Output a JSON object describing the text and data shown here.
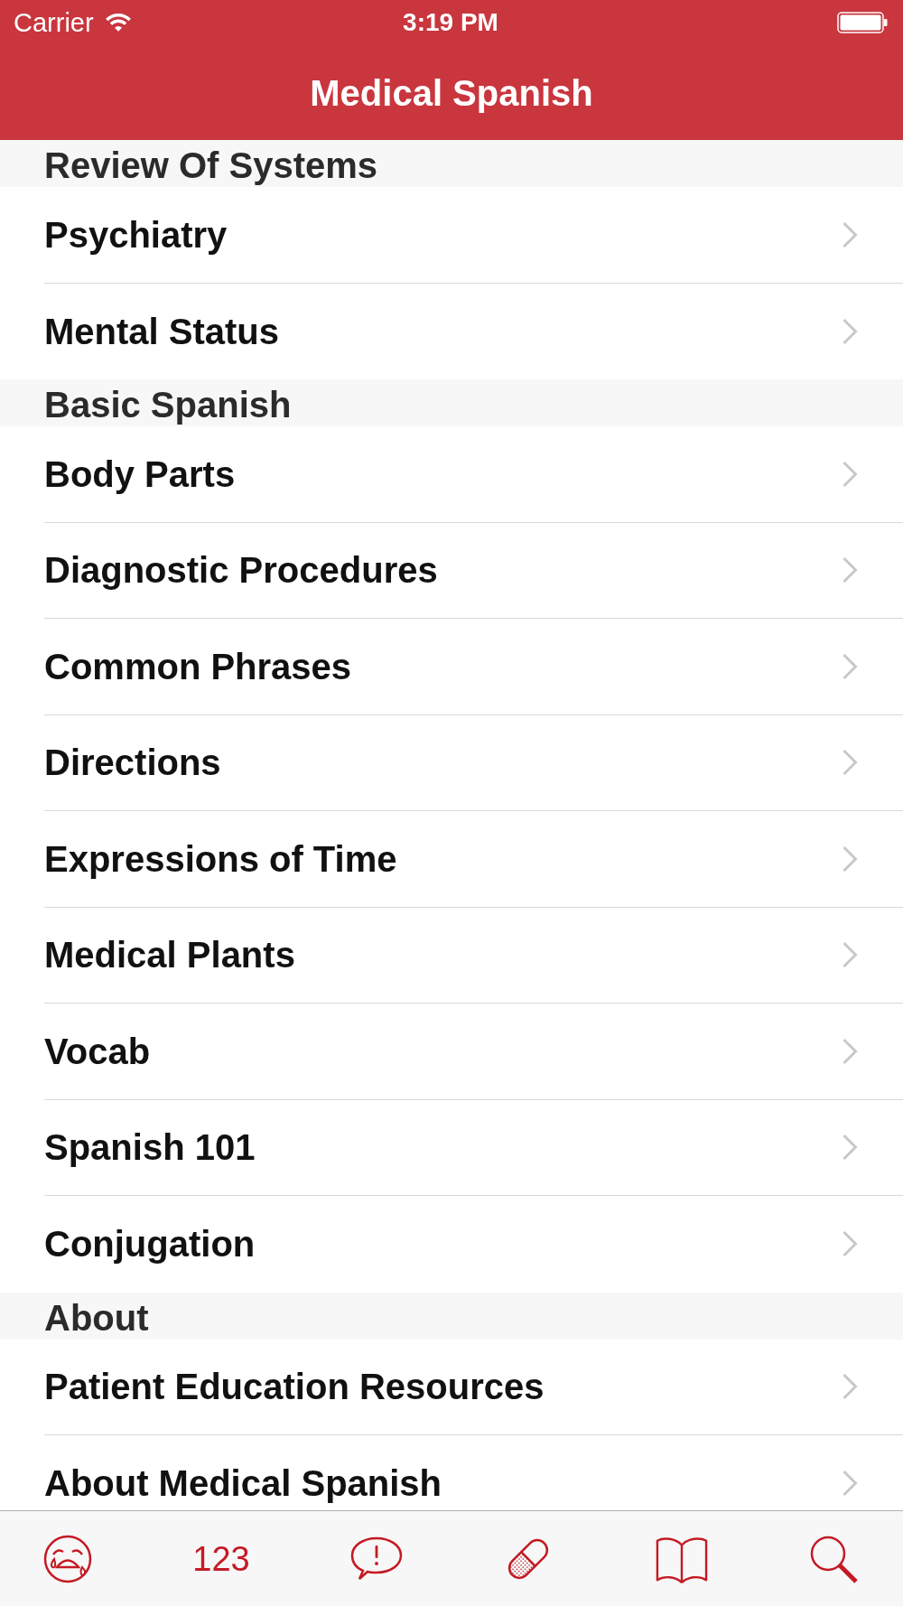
{
  "status_bar": {
    "carrier": "Carrier",
    "time": "3:19 PM"
  },
  "nav_bar": {
    "title": "Medical Spanish"
  },
  "sections": [
    {
      "header": "Review Of Systems",
      "items": [
        {
          "label": "Psychiatry"
        },
        {
          "label": "Mental Status"
        }
      ]
    },
    {
      "header": "Basic Spanish",
      "items": [
        {
          "label": "Body Parts"
        },
        {
          "label": "Diagnostic Procedures"
        },
        {
          "label": "Common Phrases"
        },
        {
          "label": "Directions"
        },
        {
          "label": "Expressions of Time"
        },
        {
          "label": "Medical Plants"
        },
        {
          "label": "Vocab"
        },
        {
          "label": "Spanish 101"
        },
        {
          "label": "Conjugation"
        }
      ]
    },
    {
      "header": "About",
      "items": [
        {
          "label": "Patient Education Resources"
        },
        {
          "label": "About Medical Spanish"
        }
      ]
    }
  ],
  "tab_bar": {
    "items": [
      {
        "kind": "crying-face"
      },
      {
        "kind": "text",
        "label": "123"
      },
      {
        "kind": "speech-bubble"
      },
      {
        "kind": "bandage"
      },
      {
        "kind": "book"
      },
      {
        "kind": "search"
      }
    ]
  }
}
